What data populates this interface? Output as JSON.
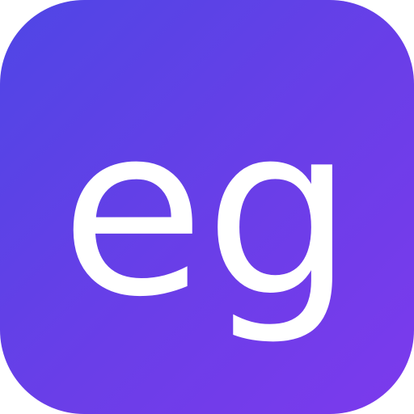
{
  "icon": {
    "label": "eg",
    "colors": {
      "gradient_start": "#4f46e5",
      "gradient_end": "#7c3aed",
      "text": "#ffffff"
    }
  }
}
